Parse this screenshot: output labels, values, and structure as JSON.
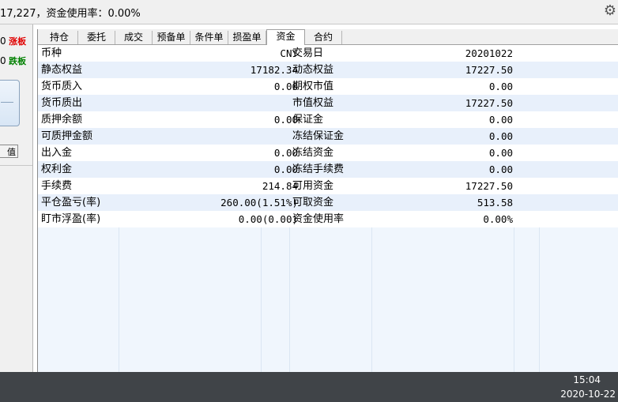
{
  "header": {
    "summary_text": "17,227，资金使用率：0.00%",
    "settings_icon": "gear-icon"
  },
  "left_panel": {
    "row1_digit": "0",
    "row1_label": "涨板",
    "row2_digit": "0",
    "row2_label": "跌板",
    "button_label": "值"
  },
  "tabs": [
    {
      "label": "持仓"
    },
    {
      "label": "委托"
    },
    {
      "label": "成交"
    },
    {
      "label": "预备单"
    },
    {
      "label": "条件单"
    },
    {
      "label": "损盈单"
    },
    {
      "label": "资金"
    },
    {
      "label": "合约"
    }
  ],
  "active_tab": "资金",
  "fund_rows": [
    {
      "label1": "币种",
      "value1": "CNY",
      "label2": "交易日",
      "value2": "20201022"
    },
    {
      "label1": "静态权益",
      "value1": "17182.34",
      "label2": "动态权益",
      "value2": "17227.50"
    },
    {
      "label1": "货币质入",
      "value1": "0.00",
      "label2": "期权市值",
      "value2": "0.00"
    },
    {
      "label1": "货币质出",
      "value1": "",
      "label2": "市值权益",
      "value2": "17227.50"
    },
    {
      "label1": "质押余额",
      "value1": "0.00",
      "label2": "保证金",
      "value2": "0.00"
    },
    {
      "label1": "可质押金额",
      "value1": "",
      "label2": "冻结保证金",
      "value2": "0.00"
    },
    {
      "label1": "出入金",
      "value1": "0.00",
      "label2": "冻结资金",
      "value2": "0.00"
    },
    {
      "label1": "权利金",
      "value1": "0.00",
      "label2": "冻结手续费",
      "value2": "0.00"
    },
    {
      "label1": "手续费",
      "value1": "214.84",
      "label2": "可用资金",
      "value2": "17227.50"
    },
    {
      "label1": "平仓盈亏(率)",
      "value1": "260.00(1.51%)",
      "label2": "可取资金",
      "value2": "513.58"
    },
    {
      "label1": "盯市浮盈(率)",
      "value1": "0.00(0.00)",
      "label2": "资金使用率",
      "value2": "0.00%"
    }
  ],
  "status": {
    "time": "15:04",
    "date": "2020-10-22"
  },
  "colors": {
    "up": "#e00000",
    "down": "#008000",
    "statusbar": "#404448"
  }
}
